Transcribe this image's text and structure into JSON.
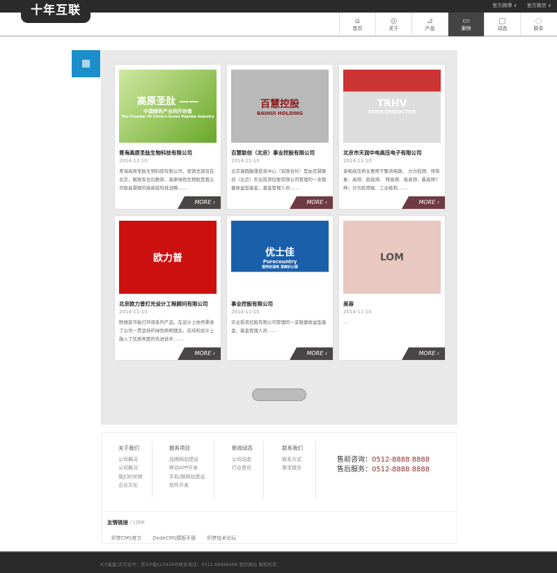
{
  "header": {
    "logo": "十年互联",
    "top_links": [
      "官方微博 ∨",
      "官方微信 ∨"
    ],
    "nav": [
      {
        "label": "首页",
        "icon": "home-icon",
        "glyph": "⌂"
      },
      {
        "label": "关于",
        "icon": "user-icon",
        "glyph": "◎"
      },
      {
        "label": "产品",
        "icon": "pen-icon",
        "glyph": "⊿"
      },
      {
        "label": "案例",
        "icon": "monitor-icon",
        "glyph": "▭",
        "active": true
      },
      {
        "label": "动态",
        "icon": "video-icon",
        "glyph": "▢"
      },
      {
        "label": "联系",
        "icon": "chat-icon",
        "glyph": "◌"
      }
    ]
  },
  "grid_icon": "grid-icon",
  "cases": [
    {
      "title": "青海高原圣肽生物科技有限公司",
      "date": "2014-11-10",
      "desc": "青海高原圣肽生物科技有限公司，营销总部设在北京，解放军总后勤部、高原绿色生物肽是我公司极具慧眼的高新肽科技战略.......",
      "img_text": "高原圣肽 ——",
      "img_sub": "中国绿色产业的开创者",
      "img_sub2": "The Founder Of China's Green Peptide Industry",
      "more": "MORE ›",
      "more_color": "#4a4646"
    },
    {
      "title": "百慧联创（北京）事业控股有限公司",
      "date": "2014-11-10",
      "desc": "北京瑞圆融晟投资中心（有限合伙）是由百慧联创（北京）实业投资控股有限公司管理的一支稳健收益型基金，基金管理人员.......",
      "img_text": "百慧控股",
      "img_sub": "BAIHUI HOLDING",
      "more": "MORE ›",
      "more_color": "#6e3a44"
    },
    {
      "title": "北京市天润中电高压电子有限公司",
      "date": "2014-11-10",
      "desc": "单相高压桥主要用于整流电路， 分为低频、快恢复、高频、超高频、 特高频、极高频、最高频7种；分为民用级、工业级和.......",
      "img_text": "TRHV",
      "img_sub": "SEMICONDUCTOR",
      "more": "MORE ›",
      "more_color": "#6e3a44"
    },
    {
      "title": "北京欧力普灯光设计工程顾问有限公司",
      "date": "2014-11-10",
      "desc": "欧丽普节能灯环保系列产品，在设计上依然秉承了公司一贯坚持的绿色照明理念。在结构设计上融入了优质亮度的先进技术.......",
      "img_text": "欧力普",
      "more": "MORE ›",
      "more_color": "#4a4646"
    },
    {
      "title": "事业控股有限公司",
      "date": "2014-11-10",
      "desc": "实业投资控股有限公司管理的一支稳健收益型基金，基金管理人员.......",
      "img_text": "优士佳",
      "img_sub": "Purecountry",
      "img_sub2": "营养好滋味 清爽好心情",
      "more": "MORE ›",
      "more_color": "#4a4646"
    },
    {
      "title": "美容",
      "date": "2014-11-10",
      "desc": "...",
      "img_text": "LOM",
      "more": "MORE ›",
      "more_color": "#4a4646"
    }
  ],
  "footer": {
    "cols": [
      {
        "title": "关于我们",
        "items": [
          "公司概况",
          "公司概况",
          "我们的优势",
          "企业文化"
        ]
      },
      {
        "title": "服务项目",
        "items": [
          "品牌网站建设",
          "移动APP开发",
          "手机/微网站建设",
          "软件开发"
        ]
      },
      {
        "title": "新闻动态",
        "items": [
          "公司动态",
          "行业资讯"
        ]
      },
      {
        "title": "联系我们",
        "items": [
          "联系方式",
          "需求提交"
        ]
      }
    ],
    "hotline": [
      {
        "label": "售前咨询：",
        "value": "0512-8888 8888"
      },
      {
        "label": "售后服务：",
        "value": "0512-8888 8888"
      }
    ],
    "links_title": "友情链接",
    "links_sub": " / LINK",
    "links": [
      "织梦CMS官方",
      "DedeCMS模板手册",
      "织梦技术论坛"
    ],
    "copyright": "ICP备案/许可证号：苏ICP备123456号联系电话：0512-88888888 我的网站 版权所有"
  }
}
